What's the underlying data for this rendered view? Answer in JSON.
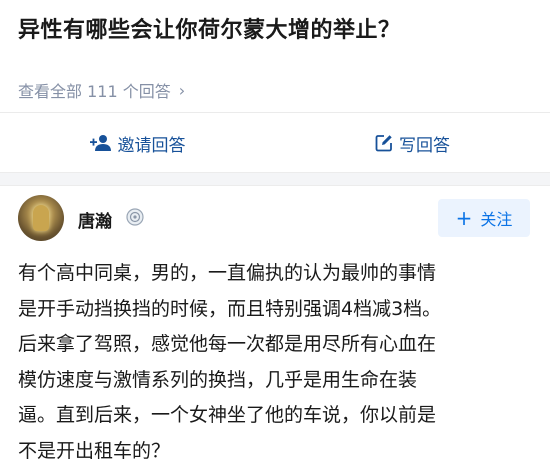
{
  "question": {
    "title": "异性有哪些会让你荷尔蒙大增的举止？",
    "view_all": "查看全部 111 个回答",
    "chevron": "›"
  },
  "actions": {
    "invite_label": "邀请回答",
    "invite_icon": "add-user-icon",
    "write_label": "写回答",
    "write_icon": "edit-icon",
    "link_color": "#175199"
  },
  "answer": {
    "author_name": "唐瀚",
    "follow_label": "关注",
    "follow_plus": "+",
    "accent": "#0b73e6",
    "lines": [
      "有个高中同桌，男的，一直偏执的认为最帅的事情",
      "是开手动挡换挡的时候，而且特别强调4档减3档。",
      "后来拿了驾照，感觉他每一次都是用尽所有心血在",
      "模仿速度与激情系列的换挡，几乎是用生命在装",
      "逼。直到后来，一个女神坐了他的车说，你以前是",
      "不是开出租车的？"
    ]
  }
}
